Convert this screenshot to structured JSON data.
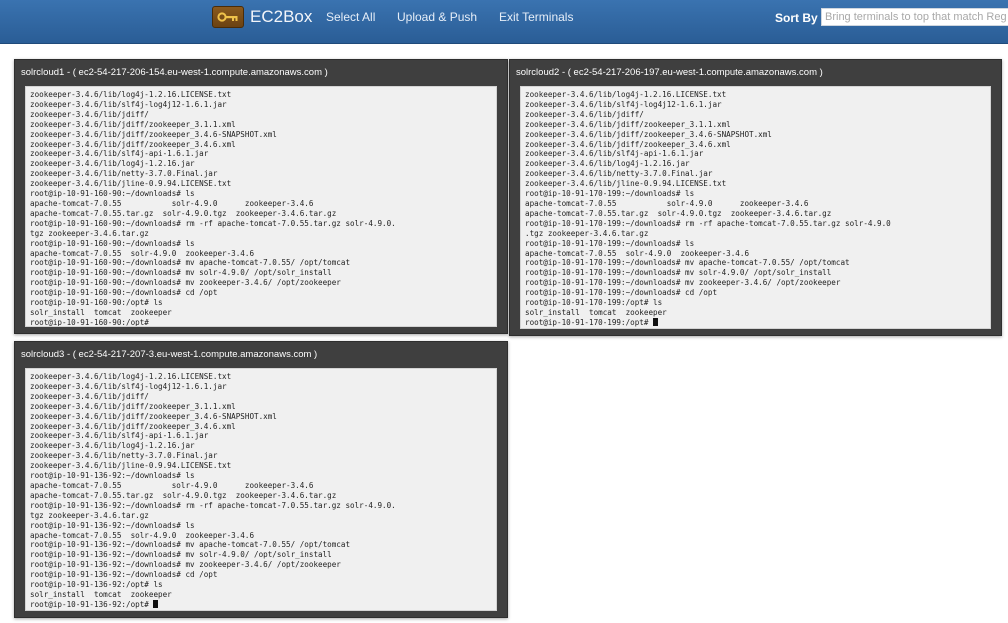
{
  "navbar": {
    "brand": "EC2Box",
    "brand_icon": "key-icon",
    "select_all": "Select All",
    "upload_push": "Upload & Push",
    "exit_terminals": "Exit Terminals",
    "sort_label": "Sort By",
    "sort_placeholder": "Bring terminals to top that match Regular Expression",
    "colors": {
      "navbar": "#2f67a3",
      "terminal_frame": "#3f3f3f",
      "terminal_screen": "#f0f0f0"
    }
  },
  "terminals": [
    {
      "title": "solrcloud1 - ( ec2-54-217-206-154.eu-west-1.compute.amazonaws.com )",
      "lines": [
        "zookeeper-3.4.6/lib/log4j-1.2.16.LICENSE.txt",
        "zookeeper-3.4.6/lib/slf4j-log4j12-1.6.1.jar",
        "zookeeper-3.4.6/lib/jdiff/",
        "zookeeper-3.4.6/lib/jdiff/zookeeper_3.1.1.xml",
        "zookeeper-3.4.6/lib/jdiff/zookeeper_3.4.6-SNAPSHOT.xml",
        "zookeeper-3.4.6/lib/jdiff/zookeeper_3.4.6.xml",
        "zookeeper-3.4.6/lib/slf4j-api-1.6.1.jar",
        "zookeeper-3.4.6/lib/log4j-1.2.16.jar",
        "zookeeper-3.4.6/lib/netty-3.7.0.Final.jar",
        "zookeeper-3.4.6/lib/jline-0.9.94.LICENSE.txt",
        "root@ip-10-91-160-90:~/downloads# ls",
        "apache-tomcat-7.0.55           solr-4.9.0      zookeeper-3.4.6",
        "apache-tomcat-7.0.55.tar.gz  solr-4.9.0.tgz  zookeeper-3.4.6.tar.gz",
        "root@ip-10-91-160-90:~/downloads# rm -rf apache-tomcat-7.0.55.tar.gz solr-4.9.0.",
        "tgz zookeeper-3.4.6.tar.gz",
        "root@ip-10-91-160-90:~/downloads# ls",
        "apache-tomcat-7.0.55  solr-4.9.0  zookeeper-3.4.6",
        "root@ip-10-91-160-90:~/downloads# mv apache-tomcat-7.0.55/ /opt/tomcat",
        "root@ip-10-91-160-90:~/downloads# mv solr-4.9.0/ /opt/solr_install",
        "root@ip-10-91-160-90:~/downloads# mv zookeeper-3.4.6/ /opt/zookeeper",
        "root@ip-10-91-160-90:~/downloads# cd /opt",
        "root@ip-10-91-160-90:/opt# ls",
        "solr_install  tomcat  zookeeper",
        "root@ip-10-91-160-90:/opt#"
      ],
      "cursor": false
    },
    {
      "title": "solrcloud2 - ( ec2-54-217-206-197.eu-west-1.compute.amazonaws.com )",
      "lines": [
        "zookeeper-3.4.6/lib/log4j-1.2.16.LICENSE.txt",
        "zookeeper-3.4.6/lib/slf4j-log4j12-1.6.1.jar",
        "zookeeper-3.4.6/lib/jdiff/",
        "zookeeper-3.4.6/lib/jdiff/zookeeper_3.1.1.xml",
        "zookeeper-3.4.6/lib/jdiff/zookeeper_3.4.6-SNAPSHOT.xml",
        "zookeeper-3.4.6/lib/jdiff/zookeeper_3.4.6.xml",
        "zookeeper-3.4.6/lib/slf4j-api-1.6.1.jar",
        "zookeeper-3.4.6/lib/log4j-1.2.16.jar",
        "zookeeper-3.4.6/lib/netty-3.7.0.Final.jar",
        "zookeeper-3.4.6/lib/jline-0.9.94.LICENSE.txt",
        "root@ip-10-91-170-199:~/downloads# ls",
        "apache-tomcat-7.0.55           solr-4.9.0      zookeeper-3.4.6",
        "apache-tomcat-7.0.55.tar.gz  solr-4.9.0.tgz  zookeeper-3.4.6.tar.gz",
        "root@ip-10-91-170-199:~/downloads# rm -rf apache-tomcat-7.0.55.tar.gz solr-4.9.0",
        ".tgz zookeeper-3.4.6.tar.gz",
        "root@ip-10-91-170-199:~/downloads# ls",
        "apache-tomcat-7.0.55  solr-4.9.0  zookeeper-3.4.6",
        "root@ip-10-91-170-199:~/downloads# mv apache-tomcat-7.0.55/ /opt/tomcat",
        "root@ip-10-91-170-199:~/downloads# mv solr-4.9.0/ /opt/solr_install",
        "root@ip-10-91-170-199:~/downloads# mv zookeeper-3.4.6/ /opt/zookeeper",
        "root@ip-10-91-170-199:~/downloads# cd /opt",
        "root@ip-10-91-170-199:/opt# ls",
        "solr_install  tomcat  zookeeper",
        "root@ip-10-91-170-199:/opt#"
      ],
      "cursor": true
    },
    {
      "title": "solrcloud3 - ( ec2-54-217-207-3.eu-west-1.compute.amazonaws.com )",
      "lines": [
        "zookeeper-3.4.6/lib/log4j-1.2.16.LICENSE.txt",
        "zookeeper-3.4.6/lib/slf4j-log4j12-1.6.1.jar",
        "zookeeper-3.4.6/lib/jdiff/",
        "zookeeper-3.4.6/lib/jdiff/zookeeper_3.1.1.xml",
        "zookeeper-3.4.6/lib/jdiff/zookeeper_3.4.6-SNAPSHOT.xml",
        "zookeeper-3.4.6/lib/jdiff/zookeeper_3.4.6.xml",
        "zookeeper-3.4.6/lib/slf4j-api-1.6.1.jar",
        "zookeeper-3.4.6/lib/log4j-1.2.16.jar",
        "zookeeper-3.4.6/lib/netty-3.7.0.Final.jar",
        "zookeeper-3.4.6/lib/jline-0.9.94.LICENSE.txt",
        "root@ip-10-91-136-92:~/downloads# ls",
        "apache-tomcat-7.0.55           solr-4.9.0      zookeeper-3.4.6",
        "apache-tomcat-7.0.55.tar.gz  solr-4.9.0.tgz  zookeeper-3.4.6.tar.gz",
        "root@ip-10-91-136-92:~/downloads# rm -rf apache-tomcat-7.0.55.tar.gz solr-4.9.0.",
        "tgz zookeeper-3.4.6.tar.gz",
        "root@ip-10-91-136-92:~/downloads# ls",
        "apache-tomcat-7.0.55  solr-4.9.0  zookeeper-3.4.6",
        "root@ip-10-91-136-92:~/downloads# mv apache-tomcat-7.0.55/ /opt/tomcat",
        "root@ip-10-91-136-92:~/downloads# mv solr-4.9.0/ /opt/solr_install",
        "root@ip-10-91-136-92:~/downloads# mv zookeeper-3.4.6/ /opt/zookeeper",
        "root@ip-10-91-136-92:~/downloads# cd /opt",
        "root@ip-10-91-136-92:/opt# ls",
        "solr_install  tomcat  zookeeper",
        "root@ip-10-91-136-92:/opt#"
      ],
      "cursor": true
    }
  ]
}
